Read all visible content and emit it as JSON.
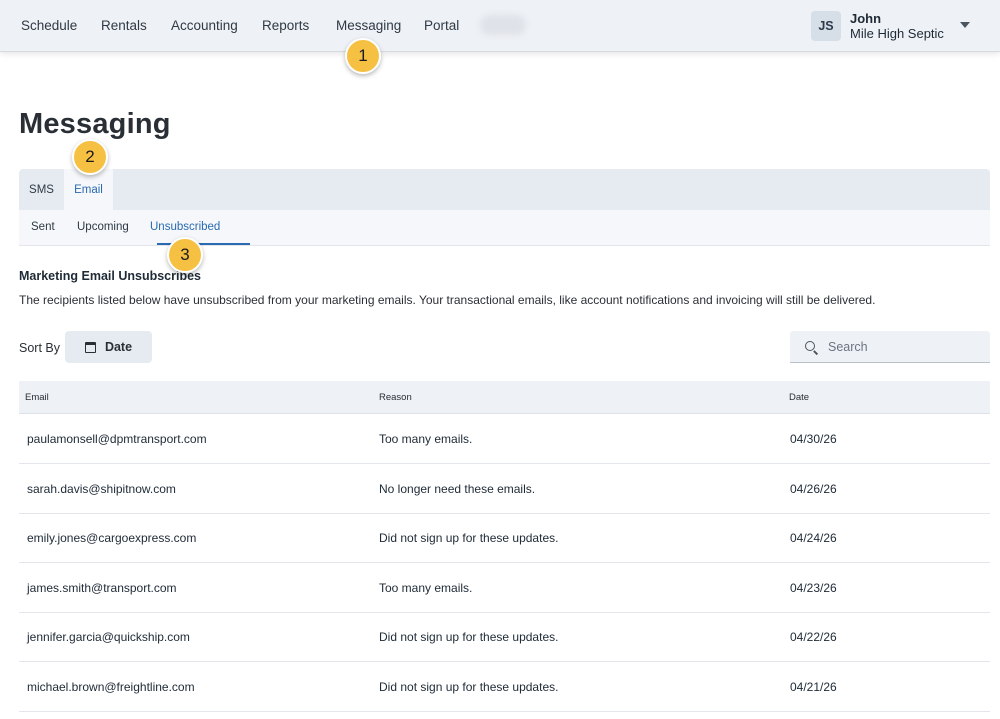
{
  "nav": {
    "items": [
      "Schedule",
      "Rentals",
      "Accounting",
      "Reports",
      "Messaging",
      "Portal"
    ],
    "user": {
      "initials": "JS",
      "name": "John",
      "company": "Mile High Septic"
    }
  },
  "steps": [
    "1",
    "2",
    "3"
  ],
  "page": {
    "title": "Messaging"
  },
  "tabs": [
    "SMS",
    "Email"
  ],
  "subtabs": [
    "Sent",
    "Upcoming",
    "Unsubscribed"
  ],
  "section": {
    "heading": "Marketing Email Unsubscribes",
    "description": "The recipients listed below have unsubscribed from your marketing emails. Your transactional emails, like account notifications and invoicing will still be delivered."
  },
  "toolbar": {
    "sort_label": "Sort By",
    "sort_value": "Date",
    "search_placeholder": "Search"
  },
  "table": {
    "columns": [
      "Email",
      "Reason",
      "Date"
    ],
    "rows": [
      {
        "email": "paulamonsell@dpmtransport.com",
        "reason": "Too many emails.",
        "date": "04/30/26"
      },
      {
        "email": "sarah.davis@shipitnow.com",
        "reason": "No longer need these emails.",
        "date": "04/26/26"
      },
      {
        "email": "emily.jones@cargoexpress.com",
        "reason": "Did not sign up for these updates.",
        "date": "04/24/26"
      },
      {
        "email": "james.smith@transport.com",
        "reason": "Too many emails.",
        "date": "04/23/26"
      },
      {
        "email": "jennifer.garcia@quickship.com",
        "reason": "Did not sign up for these updates.",
        "date": "04/22/26"
      },
      {
        "email": "michael.brown@freightline.com",
        "reason": "Did not sign up for these updates.",
        "date": "04/21/26"
      }
    ]
  },
  "colors": {
    "accent": "#2a6ab0",
    "badge": "#f6c143",
    "nav_bg": "#eef1f5"
  }
}
